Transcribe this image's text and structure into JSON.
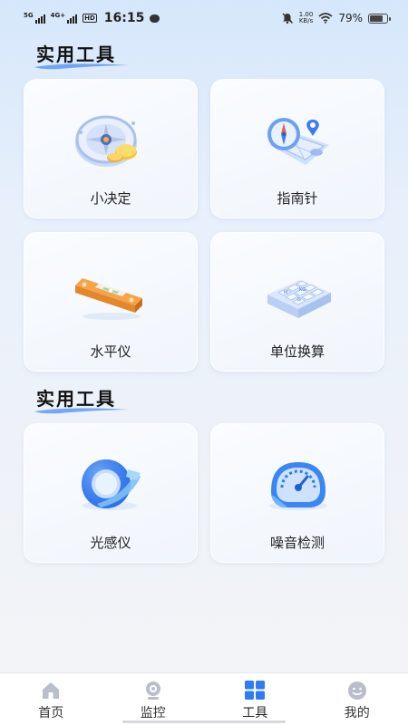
{
  "status_bar": {
    "signal1": "5G",
    "signal2": "4G+",
    "hd": "HD",
    "time": "16:15",
    "net_speed_value": "1.00",
    "net_speed_unit": "KB/s",
    "battery_percent": "79%",
    "battery_level": 0.79
  },
  "sections": [
    {
      "title": "实用工具",
      "tools": [
        {
          "label": "小决定",
          "icon": "spinner-wheel-icon"
        },
        {
          "label": "指南针",
          "icon": "compass-map-icon"
        },
        {
          "label": "水平仪",
          "icon": "spirit-level-icon"
        },
        {
          "label": "单位换算",
          "icon": "unit-keyboard-icon"
        }
      ]
    },
    {
      "title": "实用工具",
      "tools": [
        {
          "label": "光感仪",
          "icon": "light-sensor-icon"
        },
        {
          "label": "噪音检测",
          "icon": "noise-gauge-icon"
        }
      ]
    }
  ],
  "bottom_nav": {
    "items": [
      {
        "label": "首页",
        "icon": "home-icon",
        "active": false
      },
      {
        "label": "监控",
        "icon": "camera-icon",
        "active": false
      },
      {
        "label": "工具",
        "icon": "grid-tools-icon",
        "active": true
      },
      {
        "label": "我的",
        "icon": "smiley-profile-icon",
        "active": false
      }
    ]
  },
  "colors": {
    "accent": "#2f7bf6",
    "inactive_icon": "#b9bec8"
  }
}
